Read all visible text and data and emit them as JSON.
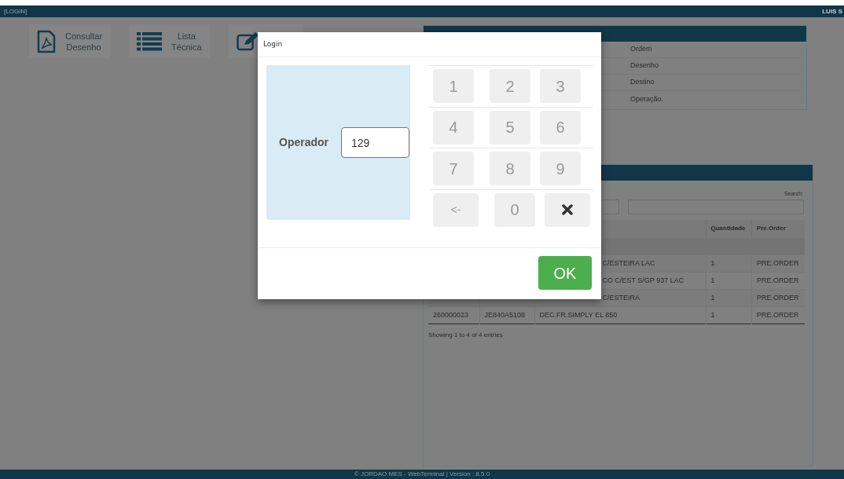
{
  "top_bar": {
    "title": "[LOGIN]",
    "user": "LUIS S"
  },
  "toolbar": [
    {
      "kind": "pdf",
      "lines": [
        "Consultar",
        "Desenho"
      ]
    },
    {
      "kind": "list",
      "lines": [
        "Lista",
        "Técnica"
      ]
    },
    {
      "kind": "edit"
    }
  ],
  "info_panel": {
    "rows": [
      "Ordem",
      "Desenho",
      "Destino",
      "Operação."
    ]
  },
  "orders_panel": {
    "search_label": "Search:",
    "columns": [
      "Quantidade",
      "Pre.Order"
    ],
    "rows": [
      {
        "description": "C/ESTEIRA LAC",
        "quantity": "1",
        "pre_order": "PRE.ORDER"
      },
      {
        "description": "CO C/EST S/GP 937 LAC",
        "quantity": "1",
        "pre_order": "PRE.ORDER"
      },
      {
        "description": "C/ESTEIRA",
        "quantity": "1",
        "pre_order": "PRE.ORDER"
      },
      {
        "order": "260000023",
        "drawing": "JE840A5108",
        "description": "DEC.FR.SIMPLY EL 850",
        "quantity": "1",
        "pre_order": "PRE.ORDER"
      }
    ],
    "info": "Showing 1 to 4 of 4 entries"
  },
  "footer": "© JORDAO MES - WebTerminal | Version : 8.5.0",
  "modal": {
    "title": "Login",
    "field_label": "Operador",
    "field_value": "129",
    "keys": [
      {
        "kind": "digit",
        "label": "1"
      },
      {
        "kind": "digit",
        "label": "2"
      },
      {
        "kind": "digit",
        "label": "3"
      },
      {
        "kind": "digit",
        "label": "4"
      },
      {
        "kind": "digit",
        "label": "5"
      },
      {
        "kind": "digit",
        "label": "6"
      },
      {
        "kind": "digit",
        "label": "7"
      },
      {
        "kind": "digit",
        "label": "8"
      },
      {
        "kind": "digit",
        "label": "9"
      },
      {
        "kind": "text",
        "label": "<-"
      },
      {
        "kind": "digit",
        "label": "0"
      },
      {
        "kind": "clear"
      }
    ],
    "ok": "OK"
  }
}
